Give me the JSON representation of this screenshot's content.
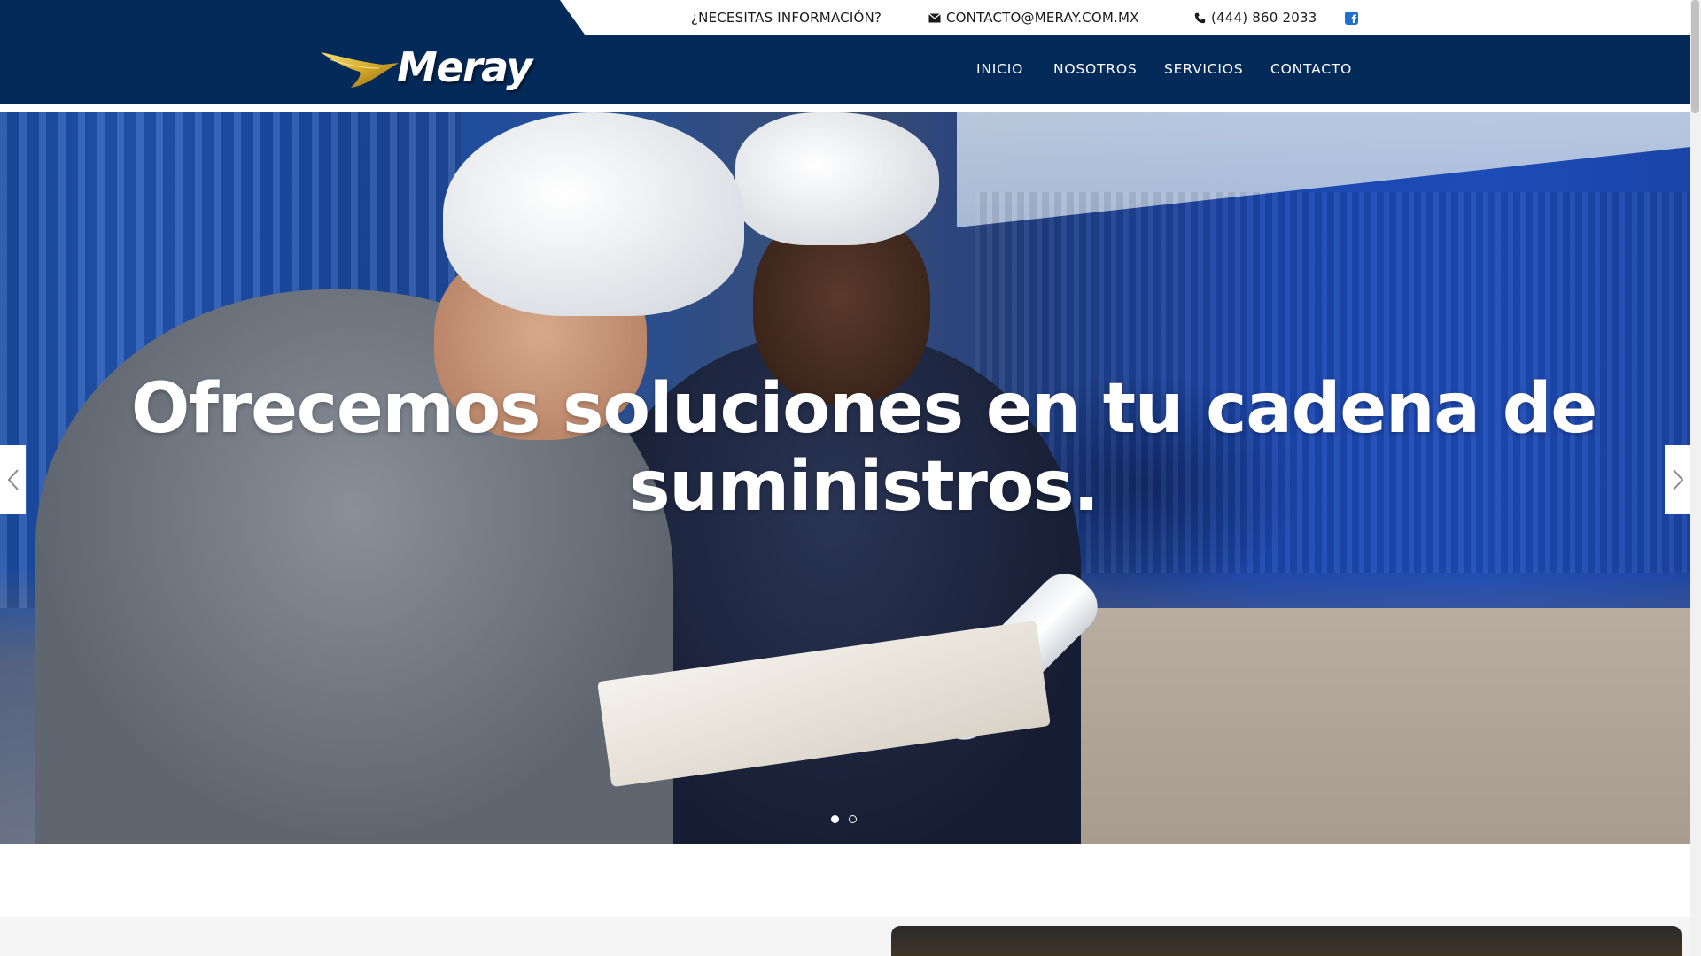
{
  "topbar": {
    "info_label": "¿NECESITAS INFORMACIÓN?",
    "email": "CONTACTO@MERAY.COM.MX",
    "phone": "(444) 860 2033",
    "icons": {
      "mail": "envelope-icon",
      "phone": "phone-icon",
      "facebook": "facebook-icon"
    }
  },
  "header": {
    "logo_text": "Meray",
    "nav": [
      {
        "label": "INICIO"
      },
      {
        "label": "NOSOTROS"
      },
      {
        "label": "SERVICIOS"
      },
      {
        "label": "CONTACTO"
      }
    ]
  },
  "hero": {
    "title": "Ofrecemos soluciones en tu cadena de suministros.",
    "slide_count": 2,
    "active_slide": 1,
    "arrows": {
      "prev": "chevron-left-icon",
      "next": "chevron-right-icon"
    }
  },
  "colors": {
    "navy": "#042a5a",
    "white": "#ffffff",
    "facebook_blue": "#1f6fd1",
    "logo_gold": "#e8c24a"
  }
}
